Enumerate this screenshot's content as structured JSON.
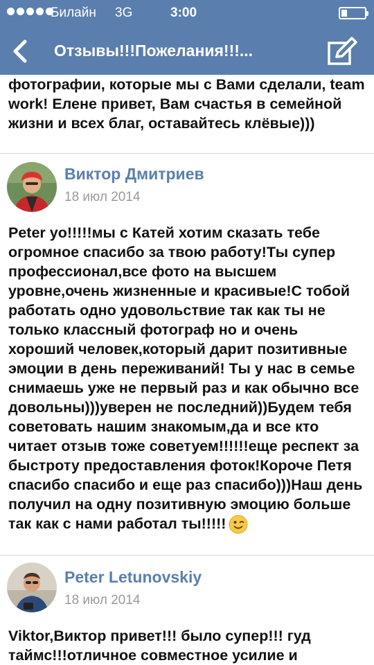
{
  "status": {
    "carrier": "Билайн",
    "network": "3G",
    "time": "3:00"
  },
  "nav": {
    "title": "Отзывы!!!Пожелания!!!...",
    "back_icon": "chevron-left-icon",
    "compose_icon": "compose-icon"
  },
  "partial_post": {
    "text": "фотографии, которые мы с Вами сделали, team work! Елене привет, Вам счастья в семейной жизни и всех благ, оставайтесь клёвые)))"
  },
  "posts": [
    {
      "author": "Виктор Дмитриев",
      "date": "18 июл 2014",
      "text": "Peter yo!!!!!мы с Катей хотим сказать тебе огромное спасибо за твою работу!Ты супер профессионал,все фото на высшем уровне,очень жизненные и красивые!С тобой работать одно удовольствие так как ты не только классный фотограф но и очень хороший человек,который дарит позитивные эмоции в день переживаний! Ты у нас в семье снимаешь уже не первый раз и как обычно все довольны)))уверен не последний))Будем тебя советовать нашим знакомым,да и все кто читает отзыв тоже советуем!!!!!!еще респект за быстроту предоставления фоток!Короче Петя спасибо спасибо и еще раз спасибо)))Наш день получил на одну позитивную эмоцию больше так как с нами работал ты!!!!!",
      "emoji": "wink-emoji-icon"
    },
    {
      "author": "Peter Letunovskiy",
      "date": "18 июл 2014",
      "text": "Viktor,Виктор привет!!! было супер!!! гуд таймс!!!отличное совместное усилие и"
    }
  ],
  "colors": {
    "bar": "#5a7fae",
    "author": "#5a7fae",
    "date": "#9a9a9a"
  }
}
